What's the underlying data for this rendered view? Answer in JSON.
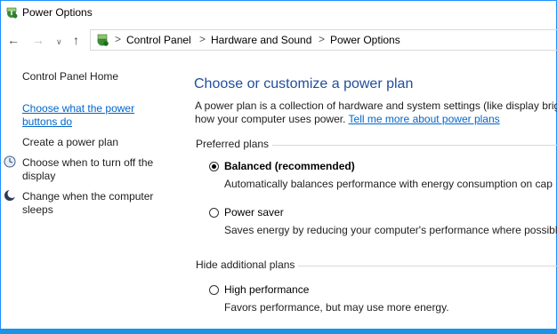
{
  "window": {
    "title": "Power Options",
    "accent_color": "#1994e6"
  },
  "nav": {
    "back_icon": "arrow-left-icon",
    "forward_icon": "arrow-right-icon",
    "recent_icon": "chevron-down-icon",
    "up_icon": "arrow-up-icon"
  },
  "breadcrumb": {
    "items": [
      "Control Panel",
      "Hardware and Sound",
      "Power Options"
    ],
    "separator": ">"
  },
  "sidebar": {
    "home": "Control Panel Home",
    "items": [
      {
        "label_line1": "Choose what the power",
        "label_line2": "buttons do",
        "icon": null
      },
      {
        "label_line1": "Create a power plan",
        "label_line2": "",
        "icon": null
      },
      {
        "label_line1": "Choose when to turn off the",
        "label_line2": "display",
        "icon": "display-clock-icon"
      },
      {
        "label_line1": "Change when the computer",
        "label_line2": "sleeps",
        "icon": "moon-icon"
      }
    ]
  },
  "main": {
    "title": "Choose or customize a power plan",
    "description_line1": "A power plan is a collection of hardware and system settings (like display brig",
    "description_line2": "how your computer uses power.",
    "description_link": "Tell me more about power plans",
    "preferred_label": "Preferred plans",
    "hide_label": "Hide additional plans",
    "plans": [
      {
        "name": "Balanced (recommended)",
        "desc": "Automatically balances performance with energy consumption on cap",
        "selected": true
      },
      {
        "name": "Power saver",
        "desc": "Saves energy by reducing your computer's performance where possibl",
        "selected": false
      },
      {
        "name": "High performance",
        "desc": "Favors performance, but may use more energy.",
        "selected": false
      }
    ]
  }
}
